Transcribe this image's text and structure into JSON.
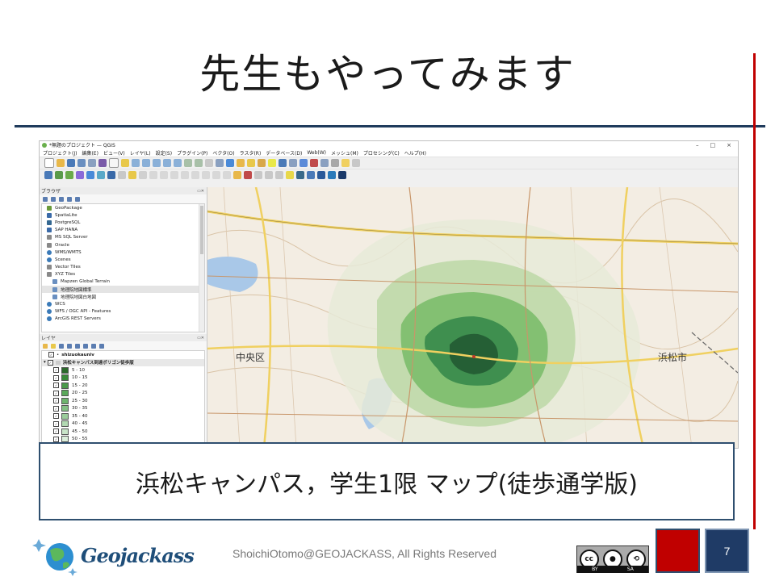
{
  "slide": {
    "title": "先生もやってみます",
    "caption": "浜松キャンパス，学生1限 マップ(徒歩通学版)",
    "copyright": "ShoichiOtomo@GEOJACKASS, All Rights Reserved",
    "page_number": "7",
    "logo_text": "Geojackass",
    "license": {
      "cc": "cc",
      "by": "BY",
      "sa": "SA"
    }
  },
  "qgis": {
    "window_title": "*無題のプロジェクト — QGIS",
    "window_controls": [
      "–",
      "□",
      "×"
    ],
    "menu": [
      "プロジェクト(J)",
      "編集(E)",
      "ビュー(V)",
      "レイヤ(L)",
      "設定(S)",
      "プラグイン(P)",
      "ベクタ(O)",
      "ラスタ(R)",
      "データベース(D)",
      "Web(W)",
      "メッシュ(M)",
      "プロセシング(C)",
      "ヘルプ(H)"
    ],
    "browser_panel": {
      "title": "ブラウザ",
      "items": [
        {
          "label": "GeoPackage",
          "color": "#6a9a3a",
          "sub": false
        },
        {
          "label": "SpatiaLite",
          "color": "#3a6aa8",
          "sub": false
        },
        {
          "label": "PostgreSQL",
          "color": "#336791",
          "sub": false
        },
        {
          "label": "SAP HANA",
          "color": "#3a6aa8",
          "sub": false
        },
        {
          "label": "MS SQL Server",
          "color": "#888888",
          "sub": false
        },
        {
          "label": "Oracle",
          "color": "#888888",
          "sub": false
        },
        {
          "label": "WMS/WMTS",
          "color": "#3a7ab8",
          "sub": false
        },
        {
          "label": "Scenes",
          "color": "#3a7ab8",
          "sub": false
        },
        {
          "label": "Vector Tiles",
          "color": "#888888",
          "sub": false
        },
        {
          "label": "XYZ Tiles",
          "color": "#888888",
          "sub": false
        },
        {
          "label": "Mapzen Global Terrain",
          "color": "#6a8fc0",
          "sub": true
        },
        {
          "label": "地理院地図標準",
          "color": "#6a8fc0",
          "sub": true
        },
        {
          "label": "地理院地図白地図",
          "color": "#6a8fc0",
          "sub": true
        },
        {
          "label": "WCS",
          "color": "#3a7ab8",
          "sub": false
        },
        {
          "label": "WFS / OGC API - Features",
          "color": "#3a7ab8",
          "sub": false
        },
        {
          "label": "ArcGIS REST Servers",
          "color": "#3a7ab8",
          "sub": false
        }
      ]
    },
    "layers_panel": {
      "title": "レイヤ",
      "layers": [
        {
          "label": "shizuokauniv",
          "bold": true
        },
        {
          "label": "浜松キャンパス到達ポリゴン徒歩版",
          "bold": true
        }
      ],
      "classes": [
        {
          "label": "5 - 10",
          "color": "#2d6a2d"
        },
        {
          "label": "10 - 15",
          "color": "#3b8a3b"
        },
        {
          "label": "15 - 20",
          "color": "#4a9a4a"
        },
        {
          "label": "20 - 25",
          "color": "#5aa85a"
        },
        {
          "label": "25 - 30",
          "color": "#6eb46e"
        },
        {
          "label": "30 - 35",
          "color": "#85c185"
        },
        {
          "label": "35 - 40",
          "color": "#9ccd9c"
        },
        {
          "label": "40 - 45",
          "color": "#b3d9b3"
        },
        {
          "label": "45 - 50",
          "color": "#c8e4c8"
        },
        {
          "label": "50 - 55",
          "color": "#dcefdc"
        }
      ]
    },
    "map": {
      "labels": {
        "chuo": "中央区",
        "hamamatsu": "浜松市"
      },
      "colors": {
        "ring1": "#e6ead8",
        "ring2": "#bfd9a8",
        "ring3": "#7fbf6f",
        "ring4": "#3f8f4f",
        "ring5": "#255f35",
        "road_major": "#f0d060",
        "road_minor": "#c8966a",
        "water": "#a9c8e8"
      }
    }
  }
}
